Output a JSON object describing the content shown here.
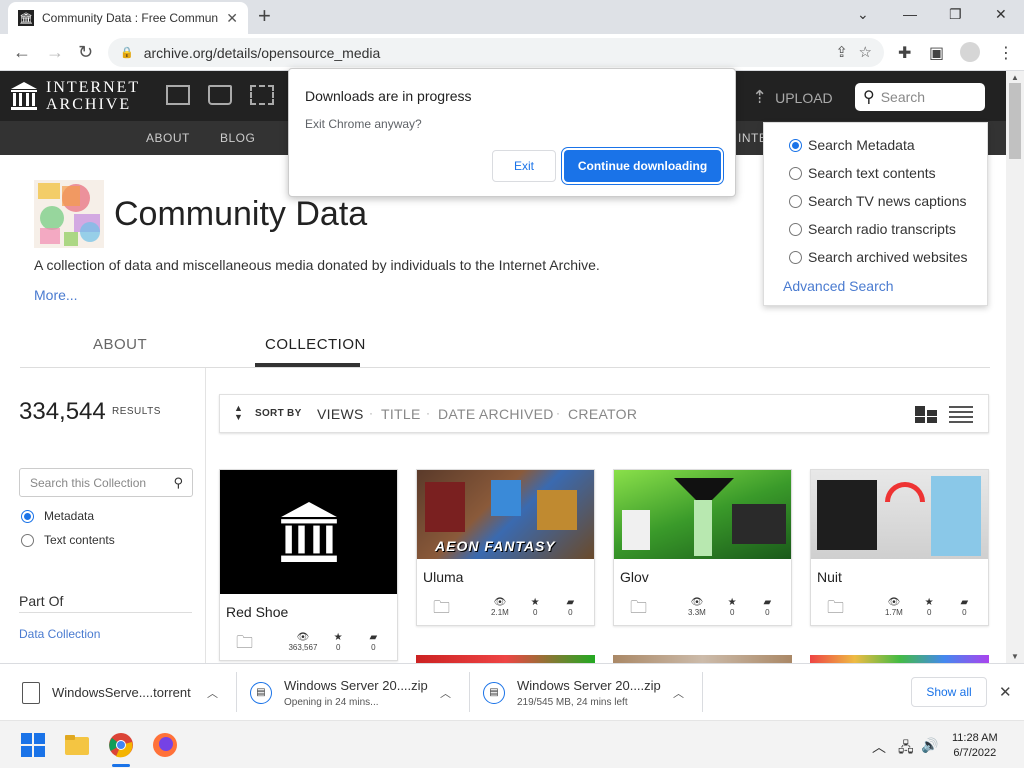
{
  "browser": {
    "tab_title": "Community Data : Free Commun",
    "url": "archive.org/details/opensource_media"
  },
  "ia_header": {
    "logo_line1": "INTERNET",
    "logo_line2": "ARCHIVE",
    "upload_label": "UPLOAD",
    "search_placeholder": "Search"
  },
  "subnav": {
    "items": [
      "ABOUT",
      "BLOG",
      "INTE"
    ]
  },
  "collection": {
    "title": "Community Data",
    "description": "A collection of data and miscellaneous media donated by individuals to the Internet Archive.",
    "more_link": "More...",
    "tabs": [
      "ABOUT",
      "COLLECTION"
    ],
    "results_count": "334,544",
    "results_label": "RESULTS",
    "search_placeholder": "Search this Collection",
    "search_options": [
      "Metadata",
      "Text contents"
    ],
    "part_of_label": "Part Of",
    "part_of_link": "Data Collection"
  },
  "sortbar": {
    "sort_by_label": "SORT BY",
    "options": [
      "VIEWS",
      "TITLE",
      "DATE ARCHIVED",
      "CREATOR"
    ]
  },
  "cards": [
    {
      "title": "Red Shoe",
      "views": "363,567",
      "favorites": "0",
      "reviews": "0"
    },
    {
      "title": "Uluma",
      "views": "2.1M",
      "favorites": "0",
      "reviews": "0",
      "thumb_text": "AEON FANTASY"
    },
    {
      "title": "Glov",
      "views": "3.3M",
      "favorites": "0",
      "reviews": "0"
    },
    {
      "title": "Nuit",
      "views": "1.7M",
      "favorites": "0",
      "reviews": "0"
    }
  ],
  "search_dropdown": {
    "options": [
      "Search Metadata",
      "Search text contents",
      "Search TV news captions",
      "Search radio transcripts",
      "Search archived websites"
    ],
    "advanced": "Advanced Search"
  },
  "dialog": {
    "title": "Downloads are in progress",
    "message": "Exit Chrome anyway?",
    "exit_label": "Exit",
    "continue_label": "Continue downloading"
  },
  "downloads": [
    {
      "name": "WindowsServe....torrent",
      "status": ""
    },
    {
      "name": "Windows Server 20....zip",
      "status": "Opening in 24 mins..."
    },
    {
      "name": "Windows Server 20....zip",
      "status": "219/545 MB, 24 mins left"
    }
  ],
  "downloads_show_all": "Show all",
  "taskbar": {
    "time": "11:28 AM",
    "date": "6/7/2022"
  },
  "colors": {
    "accent": "#1a73e8",
    "link": "#4a7bd0",
    "ia_header": "#222222"
  }
}
